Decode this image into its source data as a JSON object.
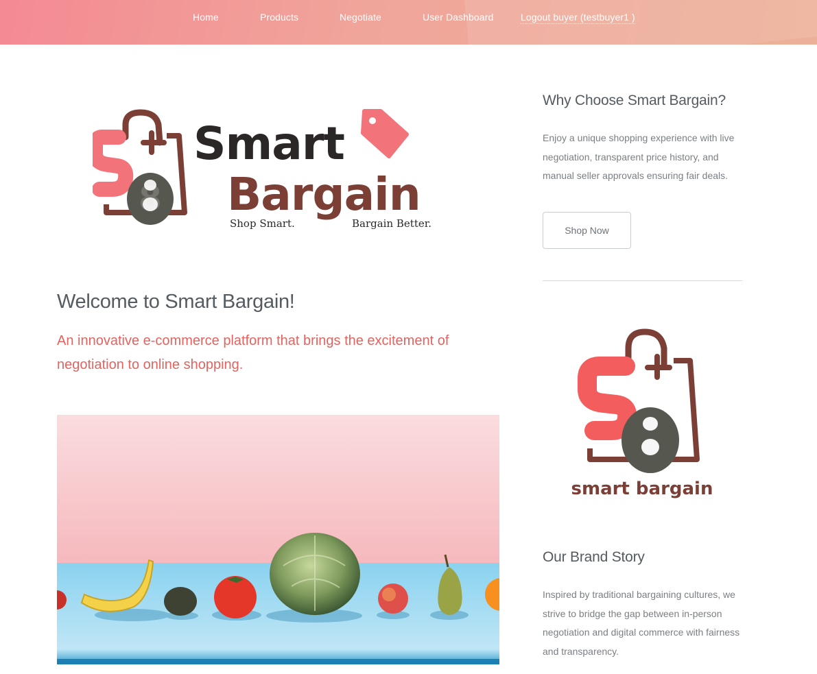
{
  "nav": {
    "items": [
      {
        "label": "Home"
      },
      {
        "label": "Products"
      },
      {
        "label": "Negotiate"
      },
      {
        "label": "User Dashboard"
      }
    ],
    "logout_label": "Logout buyer (testbuyer1 )"
  },
  "logo_main": {
    "line1": "Smart",
    "line2": "Bargain",
    "tagline_left": "Shop Smart.",
    "tagline_right": "Bargain Better."
  },
  "welcome": {
    "title": "Welcome to Smart Bargain!",
    "subtitle": "An innovative e-commerce platform that brings the excitement of negotiation to online shopping."
  },
  "sidebar": {
    "why_title": "Why Choose Smart Bargain?",
    "why_text": "Enjoy a unique shopping experience with live negotiation, transparent price history, and manual seller approvals ensuring fair deals.",
    "shop_button": "Shop Now",
    "brand_logo_text": "smart bargain",
    "story_title": "Our Brand Story",
    "story_text": "Inspired by traditional bargaining cultures, we strive to bridge the gap between in-person negotiation and digital commerce with fairness and transparency."
  },
  "colors": {
    "nav_gradient_start": "#f48a93",
    "nav_gradient_end": "#ecb098",
    "accent_coral": "#e2635f",
    "logo_dark": "#2b2727",
    "logo_brown": "#7b3f36",
    "logo_pink": "#f3737b",
    "logo_gray": "#56574e"
  }
}
